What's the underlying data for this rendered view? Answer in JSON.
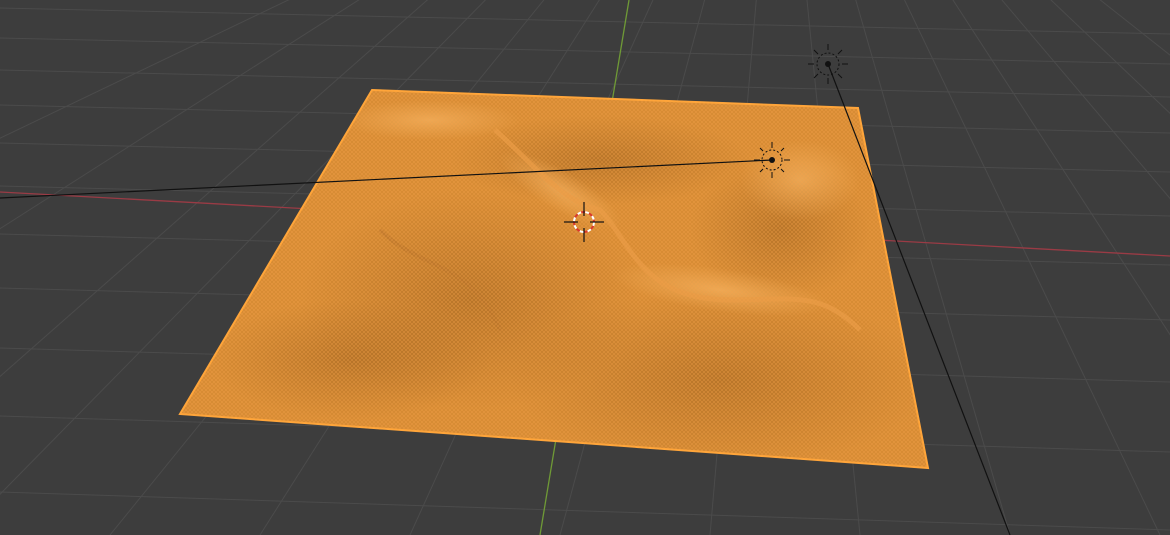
{
  "viewport": {
    "view": "3D Viewport",
    "background_color": "#3d3d3d",
    "grid_color": "#4a4a4a",
    "axis_x_color": "#9a3b45",
    "axis_y_color": "#6f9a36"
  },
  "scene": {
    "selected_object": {
      "type": "terrain-plane-mesh",
      "display": "wireframe",
      "state": "selected",
      "fill_color": "#d88a2f",
      "wire_color": "#f59a32",
      "outline_color": "#ffa53a"
    },
    "objects": [
      {
        "type": "sun-light",
        "icon": "sun-light-icon"
      },
      {
        "type": "point-light",
        "icon": "light-icon"
      },
      {
        "type": "3d-cursor",
        "icon": "3d-cursor-icon"
      }
    ]
  }
}
